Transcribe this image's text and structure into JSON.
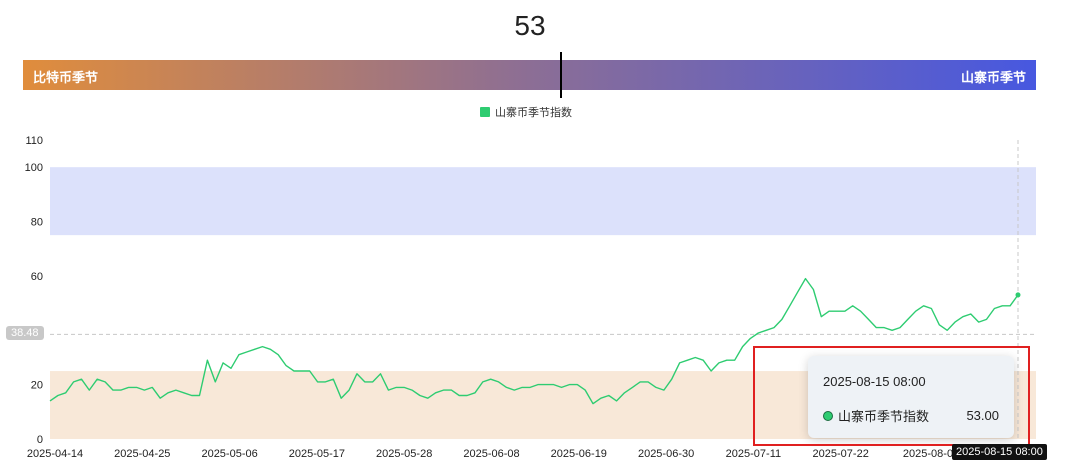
{
  "indicator": {
    "value": "53",
    "left_label": "比特币季节",
    "right_label": "山寨币季节"
  },
  "legend": {
    "label": "山寨币季节指数",
    "color": "#2ecc71"
  },
  "tooltip": {
    "date": "2025-08-15 08:00",
    "series_label": "山寨币季节指数",
    "value": "53.00"
  },
  "crosshair": {
    "y_value_label": "38.48",
    "x_label": "2025-08-15 08:00"
  },
  "colors": {
    "line": "#2ecc71",
    "upper_band": "#dce1fb",
    "lower_band": "#f8e8d8",
    "highlight": "#e02020"
  },
  "chart_data": {
    "type": "line",
    "title": "",
    "xlabel": "",
    "ylabel": "",
    "ylim": [
      0,
      110
    ],
    "yticks": [
      0,
      20,
      40,
      60,
      80,
      100,
      110
    ],
    "ytick_labels": [
      "0",
      "20",
      "",
      "60",
      "80",
      "100",
      "110"
    ],
    "xtick_labels": [
      "2025-04-14",
      "2025-04-25",
      "2025-05-06",
      "2025-05-17",
      "2025-05-28",
      "2025-06-08",
      "2025-06-19",
      "2025-06-30",
      "2025-07-11",
      "2025-07-22",
      "2025-08-0",
      "2025-08-15 08:00"
    ],
    "bands": [
      {
        "from": 75,
        "to": 100,
        "label": ""
      },
      {
        "from": 0,
        "to": 25,
        "label": ""
      }
    ],
    "series": [
      {
        "name": "山寨币季节指数",
        "x": [
          "2025-04-14",
          "2025-04-15",
          "2025-04-16",
          "2025-04-17",
          "2025-04-18",
          "2025-04-19",
          "2025-04-20",
          "2025-04-21",
          "2025-04-22",
          "2025-04-23",
          "2025-04-24",
          "2025-04-25",
          "2025-04-26",
          "2025-04-27",
          "2025-04-28",
          "2025-04-29",
          "2025-04-30",
          "2025-05-01",
          "2025-05-02",
          "2025-05-03",
          "2025-05-04",
          "2025-05-05",
          "2025-05-06",
          "2025-05-07",
          "2025-05-08",
          "2025-05-09",
          "2025-05-10",
          "2025-05-11",
          "2025-05-12",
          "2025-05-13",
          "2025-05-14",
          "2025-05-15",
          "2025-05-16",
          "2025-05-17",
          "2025-05-18",
          "2025-05-19",
          "2025-05-20",
          "2025-05-21",
          "2025-05-22",
          "2025-05-23",
          "2025-05-24",
          "2025-05-25",
          "2025-05-26",
          "2025-05-27",
          "2025-05-28",
          "2025-05-29",
          "2025-05-30",
          "2025-05-31",
          "2025-06-01",
          "2025-06-02",
          "2025-06-03",
          "2025-06-04",
          "2025-06-05",
          "2025-06-06",
          "2025-06-07",
          "2025-06-08",
          "2025-06-09",
          "2025-06-10",
          "2025-06-11",
          "2025-06-12",
          "2025-06-13",
          "2025-06-14",
          "2025-06-15",
          "2025-06-16",
          "2025-06-17",
          "2025-06-18",
          "2025-06-19",
          "2025-06-20",
          "2025-06-21",
          "2025-06-22",
          "2025-06-23",
          "2025-06-24",
          "2025-06-25",
          "2025-06-26",
          "2025-06-27",
          "2025-06-28",
          "2025-06-29",
          "2025-06-30",
          "2025-07-01",
          "2025-07-02",
          "2025-07-03",
          "2025-07-04",
          "2025-07-05",
          "2025-07-06",
          "2025-07-07",
          "2025-07-08",
          "2025-07-09",
          "2025-07-10",
          "2025-07-11",
          "2025-07-12",
          "2025-07-13",
          "2025-07-14",
          "2025-07-15",
          "2025-07-16",
          "2025-07-17",
          "2025-07-18",
          "2025-07-19",
          "2025-07-20",
          "2025-07-21",
          "2025-07-22",
          "2025-07-23",
          "2025-07-24",
          "2025-07-25",
          "2025-07-26",
          "2025-07-27",
          "2025-07-28",
          "2025-07-29",
          "2025-07-30",
          "2025-07-31",
          "2025-08-01",
          "2025-08-02",
          "2025-08-03",
          "2025-08-04",
          "2025-08-05",
          "2025-08-06",
          "2025-08-07",
          "2025-08-08",
          "2025-08-09",
          "2025-08-10",
          "2025-08-11",
          "2025-08-12",
          "2025-08-13",
          "2025-08-14",
          "2025-08-15"
        ],
        "values": [
          14,
          16,
          17,
          21,
          22,
          18,
          22,
          21,
          18,
          18,
          19,
          19,
          18,
          19,
          15,
          17,
          18,
          17,
          16,
          16,
          29,
          21,
          28,
          26,
          31,
          32,
          33,
          34,
          33,
          31,
          27,
          25,
          25,
          25,
          21,
          21,
          22,
          15,
          18,
          24,
          21,
          21,
          24,
          18,
          19,
          19,
          18,
          16,
          15,
          17,
          18,
          18,
          16,
          16,
          17,
          21,
          22,
          21,
          19,
          18,
          19,
          19,
          20,
          20,
          20,
          19,
          20,
          20,
          18,
          13,
          15,
          16,
          14,
          17,
          19,
          21,
          21,
          19,
          18,
          22,
          28,
          29,
          30,
          29,
          25,
          28,
          29,
          29,
          34,
          37,
          39,
          40,
          41,
          44,
          49,
          54,
          59,
          55,
          45,
          47,
          47,
          47,
          49,
          47,
          44,
          41,
          41,
          40,
          41,
          44,
          47,
          49,
          48,
          42,
          40,
          43,
          45,
          46,
          43,
          44,
          48,
          49,
          49,
          53
        ],
        "color": "#2ecc71"
      }
    ]
  }
}
